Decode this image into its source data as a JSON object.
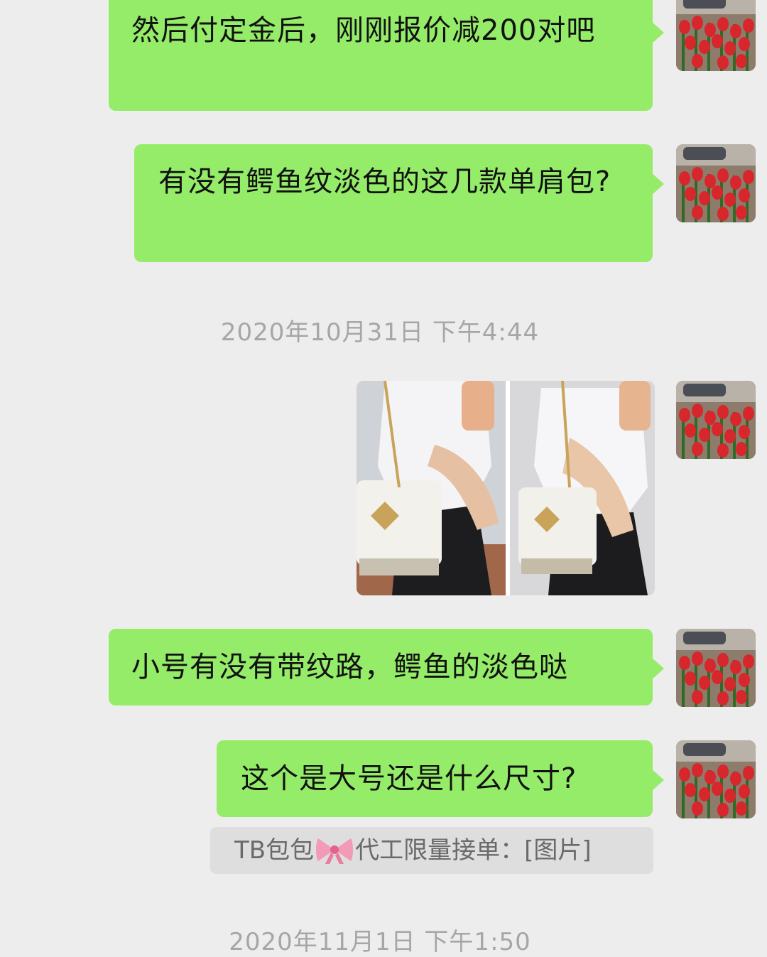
{
  "messages": [
    {
      "id": "m1",
      "text": "然后付定金后，刚刚报价减200对吧"
    },
    {
      "id": "m2",
      "text": "有没有鳄鱼纹淡色的这几款单肩包?"
    },
    {
      "id": "m3",
      "text": "小号有没有带纹路，鳄鱼的淡色哒"
    },
    {
      "id": "m4",
      "text": "这个是大号还是什么尺寸?"
    }
  ],
  "timestamps": {
    "t1": "2020年10月31日 下午4:44",
    "t2": "2020年11月1日 下午1:50"
  },
  "quote": {
    "sender": "TB包包",
    "sender_suffix": "代工限量接单：",
    "content": "[图片]",
    "icon": "pink-bow-emoji"
  },
  "avatar": {
    "icon": "red-tulips-avatar"
  },
  "colors": {
    "background": "#ededed",
    "bubble_self": "#95ec69",
    "timestamp_text": "#a6a6a6",
    "quote_bg": "#dedede"
  }
}
